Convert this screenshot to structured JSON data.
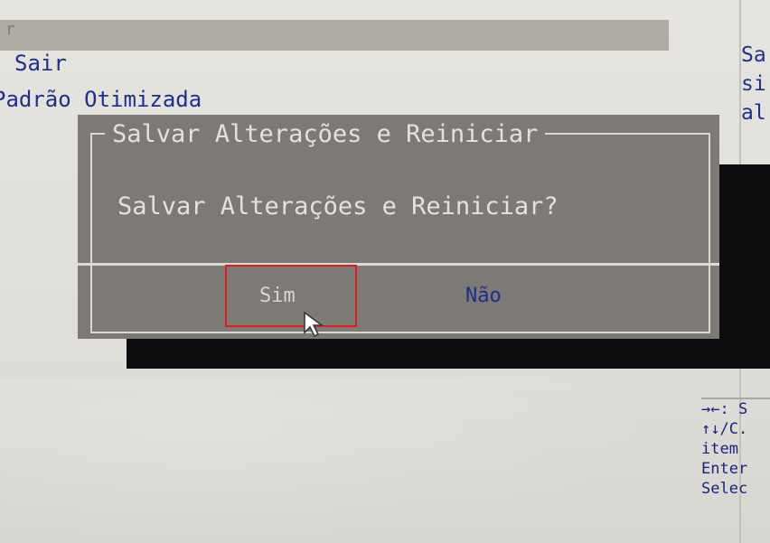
{
  "background": {
    "top_fragment": "r",
    "menu_items": [
      "Sair",
      "Padrão Otimizada"
    ],
    "right_fragments": [
      "Sa",
      "si",
      "al"
    ],
    "help_lines": [
      "→←: S",
      "↑↓/C.",
      "item",
      "Enter",
      "Selec"
    ]
  },
  "dialog": {
    "title": "Salvar Alterações e Reiniciar",
    "question": "Salvar Alterações e Reiniciar?",
    "buttons": {
      "yes": "Sim",
      "no": "Não"
    }
  },
  "colors": {
    "dialog_bg": "#7d7a76",
    "menu_text": "#1f2f8f",
    "highlight_box": "#e11c1c",
    "shadow": "#0d0d0f"
  },
  "icons": [
    "mouse-pointer-icon"
  ]
}
